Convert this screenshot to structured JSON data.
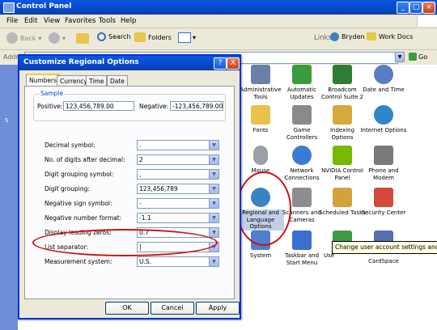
{
  "window": {
    "title": "Control Panel"
  },
  "menu": [
    "File",
    "Edit",
    "View",
    "Favorites",
    "Tools",
    "Help"
  ],
  "toolbar": {
    "back": "Back",
    "search": "Search",
    "folders": "Folders"
  },
  "links": {
    "label": "Links",
    "bryden": "Bryden",
    "workdocs": "Work Docs"
  },
  "address": {
    "label": "Addre",
    "go": "Go"
  },
  "left_stub": {
    "s": "S"
  },
  "cp_items": [
    {
      "label": "Administrative Tools",
      "color": "#6b7fa8"
    },
    {
      "label": "Automatic Updates",
      "color": "#3b9c3b"
    },
    {
      "label": "Broadcom Control Suite 2",
      "color": "#2e7d32"
    },
    {
      "label": "Date and Time",
      "color": "#5b7bc9"
    },
    {
      "label": "Fonts",
      "color": "#e8c24a"
    },
    {
      "label": "Game Controllers",
      "color": "#8a8a8a"
    },
    {
      "label": "Indexing Options",
      "color": "#d6a93c"
    },
    {
      "label": "Internet Options",
      "color": "#2f86c9"
    },
    {
      "label": "Mouse",
      "color": "#9aa0a6"
    },
    {
      "label": "Network Connections",
      "color": "#3a7bd5"
    },
    {
      "label": "NVIDIA Control Panel",
      "color": "#76b900"
    },
    {
      "label": "Phone and Modem",
      "color": "#7a7a7a"
    },
    {
      "label": "Regional and Language Options",
      "color": "#3b82c4"
    },
    {
      "label": "Scanners and Cameras",
      "color": "#8d8d8d"
    },
    {
      "label": "Scheduled Tasks",
      "color": "#d4a23c"
    },
    {
      "label": "Security Center",
      "color": "#d44a3a"
    },
    {
      "label": "System",
      "color": "#4f7fcf"
    },
    {
      "label": "Taskbar and Start Menu",
      "color": "#3a6fd0"
    },
    {
      "label": "Use",
      "color": "#3f9b45"
    },
    {
      "label": "CardSpace",
      "color": "#5070b0"
    }
  ],
  "tooltip": "Change user account settings and pass",
  "dialog": {
    "title": "Customize Regional Options",
    "help": "?",
    "close": "X",
    "tabs": [
      "Numbers",
      "Currency",
      "Time",
      "Date"
    ],
    "sample": {
      "legend": "Sample",
      "positive_label": "Positive:",
      "positive_value": "123,456,789.00",
      "negative_label": "Negative:",
      "negative_value": "-123,456,789.00"
    },
    "fields": [
      {
        "label": "Decimal symbol:",
        "value": "."
      },
      {
        "label": "No. of digits after decimal:",
        "value": "2"
      },
      {
        "label": "Digit grouping symbol:",
        "value": ","
      },
      {
        "label": "Digit grouping:",
        "value": "123,456,789"
      },
      {
        "label": "Negative sign symbol:",
        "value": "-"
      },
      {
        "label": "Negative number format:",
        "value": "-1.1"
      },
      {
        "label": "Display leading zeros:",
        "value": "0.7"
      },
      {
        "label": "List separator:",
        "value": "|"
      },
      {
        "label": "Measurement system:",
        "value": "U.S."
      }
    ],
    "buttons": {
      "ok": "OK",
      "cancel": "Cancel",
      "apply": "Apply"
    }
  }
}
